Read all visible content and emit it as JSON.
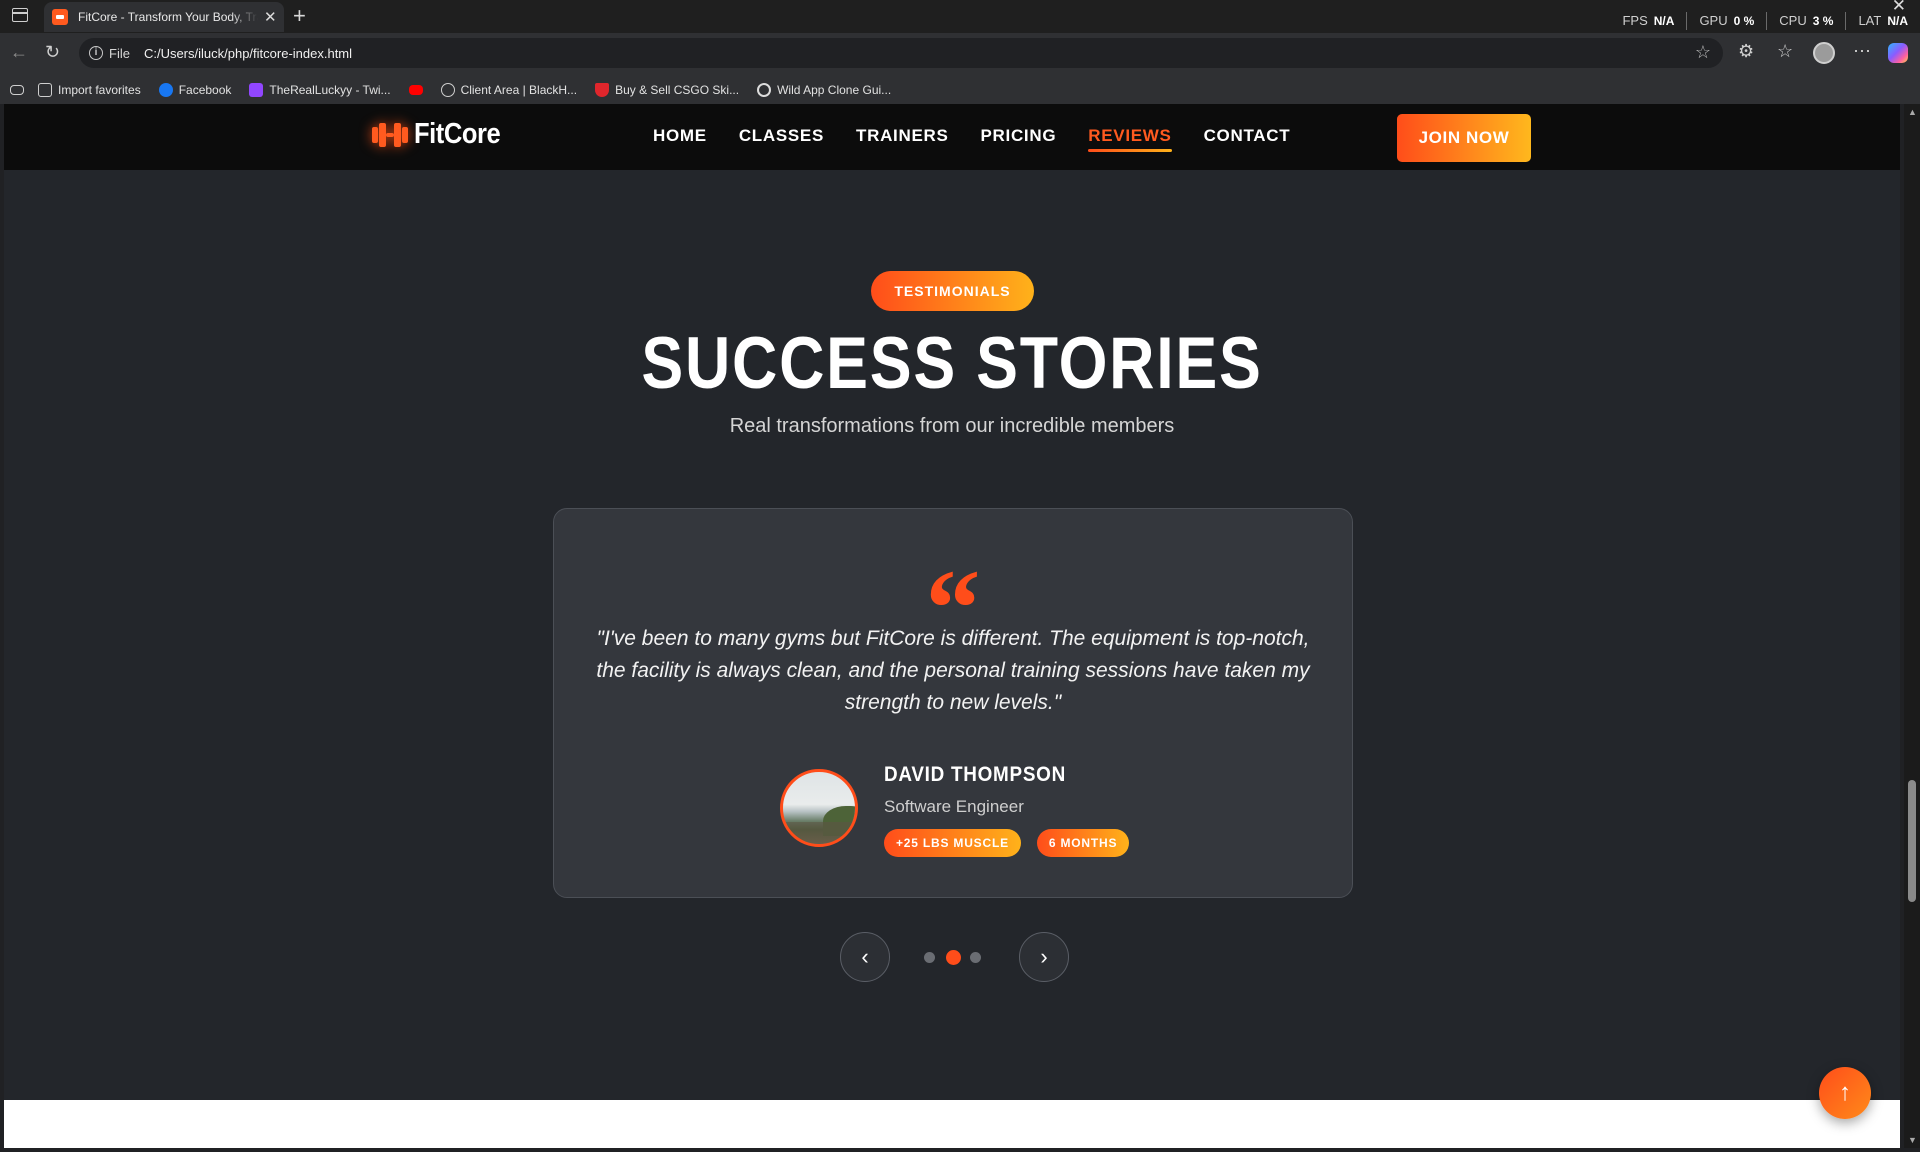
{
  "browser": {
    "tab_title": "FitCore - Transform Your Body, Transform Your Life",
    "file_label": "File",
    "url": "C:/Users/iluck/php/fitcore-index.html",
    "perf": [
      {
        "label": "FPS",
        "value": "N/A"
      },
      {
        "label": "GPU",
        "value": "0 %"
      },
      {
        "label": "CPU",
        "value": "3 %"
      },
      {
        "label": "LAT",
        "value": "N/A"
      }
    ],
    "bookmarks": [
      {
        "label": "Import favorites",
        "icon": "folder-icon",
        "color": "#cfcfcf"
      },
      {
        "label": "Facebook",
        "icon": "facebook-icon",
        "color": "#1877f2"
      },
      {
        "label": "TheRealLuckyy - Twi...",
        "icon": "twitch-icon",
        "color": "#9146ff"
      },
      {
        "label": "",
        "icon": "youtube-icon",
        "color": "#ff0000"
      },
      {
        "label": "Client Area | BlackH...",
        "icon": "globe-icon",
        "color": "#cfcfcf"
      },
      {
        "label": "Buy & Sell CSGO Ski...",
        "icon": "shield-icon",
        "color": "#e0262c"
      },
      {
        "label": "Wild App Clone Gui...",
        "icon": "chatgpt-icon",
        "color": "#dcdcdc"
      }
    ]
  },
  "site": {
    "brand": "FitCore",
    "menu": [
      {
        "label": "HOME",
        "active": false
      },
      {
        "label": "CLASSES",
        "active": false
      },
      {
        "label": "TRAINERS",
        "active": false
      },
      {
        "label": "PRICING",
        "active": false
      },
      {
        "label": "REVIEWS",
        "active": true
      },
      {
        "label": "CONTACT",
        "active": false
      }
    ],
    "join_label": "JOIN NOW",
    "accent": "#ff4d1a",
    "accent_end": "#ffb21a"
  },
  "testimonials": {
    "badge": "TESTIMONIALS",
    "title": "SUCCESS STORIES",
    "subtitle": "Real transformations from our incredible members",
    "quote_mark": "“",
    "quote": "\"I've been to many gyms but FitCore is different. The equipment is top-notch, the facility is always clean, and the personal training sessions have taken my strength to new levels.\"",
    "author_name": "DAVID THOMPSON",
    "author_role": "Software Engineer",
    "stats": [
      "+25 LBS MUSCLE",
      "6 MONTHS"
    ],
    "slide_count": 3,
    "active_slide": 2
  }
}
